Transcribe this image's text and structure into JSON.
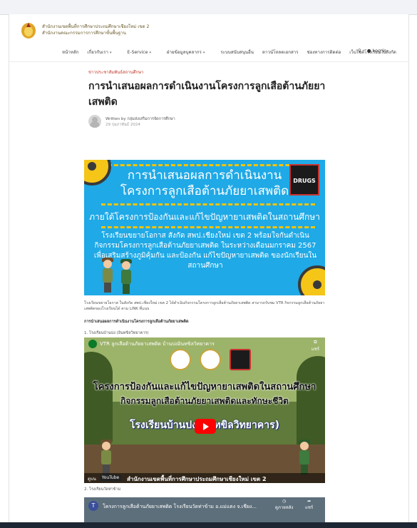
{
  "site": {
    "name_line1": "สำนักงานเขตพื้นที่การศึกษาประถมศึกษาเชียงใหม่ เขต 2",
    "name_line2": "สำนักงานคณะกรรมการการศึกษาขั้นพื้นฐาน"
  },
  "nav": {
    "items": [
      "หน้าหลัก",
      "เกี่ยวกับเรา",
      "E-Service",
      "ฝ่ายข้อมูลบุคลากร",
      "ระบบสนับสนุนอื่น",
      "ดาวน์โหลดเอกสาร",
      "ช่องทางการติดต่อ",
      "เว็บไซต์โรงเรียนในสังกัด"
    ],
    "login_label": "Log in"
  },
  "article": {
    "category": "ข่าวประชาสัมพันธ์สถานศึกษา",
    "title": "การนำเสนอผลการดำเนินงานโครงการลูกเสือต้านภัยยาเสพติด",
    "author": "Written by กลุ่มส่งเสริมการจัดการศึกษา",
    "date": "29 กุมภาพันธ์ 2024",
    "body": "โรงเรียนขยายโอกาส ในสังกัด สพป.เชียงใหม่ เขต 2 ได้ดำเนินกิจกรรมโครงการลูกเสือต้านภัยยาเสพติด สามารถรับชม VTR กิจกรรมลูกเสือต้านภัยยาเสพติดของโรงเรียนได้ ตาม LINK ที่แนบ",
    "subhead": "การนำเสนอผลการดำเนินงานโครงการลูกเสือต้านภัยยาเสพติด",
    "item1": "1. โรงเรียนบ้านปง (อินทขิลวิทยาคาร)",
    "item2": "2. โรงเรียนวัดท่าข้าม"
  },
  "poster": {
    "line1": "การนำเสนอผลการดำเนินงาน",
    "line2": "โครงการลูกเสือต้านภัยยาเสพติด",
    "line3": "ภายใต้โครงการป้องกันและแก้ไขปัญหายาเสพติดในสถานศึกษา",
    "line4": "โรงเรียนขยายโอกาส สังกัด สพป.เชียงใหม่ เขต 2 พร้อมใจกันดำเนินกิจกรรมโครงการลูกเสือต้านภัยยาเสพติด ในระหว่างเดือนมกราคม 2567 เพื่อเสริมสร้างภูมิคุ้มกัน และป้องกัน แก้ไขปัญหายาเสพติด ของนักเรียนในสถานศึกษา",
    "badge": "DRUGS"
  },
  "video1": {
    "title": "VTR ลูกเสือต้านภัยยาเสพติด บ้านปงอินทขิลวิทยาคาร",
    "share_label": "แชร์",
    "heading1": "โครงการป้องกันและแก้ไขปัญหายาเสพติดในสถานศึกษา",
    "heading2": "กิจกรรมลูกเสือต้านภัยยาเสพติดและทักษะชีวิต",
    "heading3": "โรงเรียนบ้านปง(อินทขิลวิทยาคาร)",
    "watch_on": "ดูบน",
    "youtube": "YouTube",
    "office": "สำนักงานเขตพื้นที่การศึกษาประถมศึกษาเชียงใหม่ เขต 2"
  },
  "video2": {
    "channel_initial": "T",
    "title": "โครงการลูกเสือต้านภัยยาเสพติด โรงเรียนวัดท่าข้าม อ.แม่แตง จ.เชียง...",
    "watch_later": "ดูภายหลัง",
    "share_label": "แชร์"
  }
}
